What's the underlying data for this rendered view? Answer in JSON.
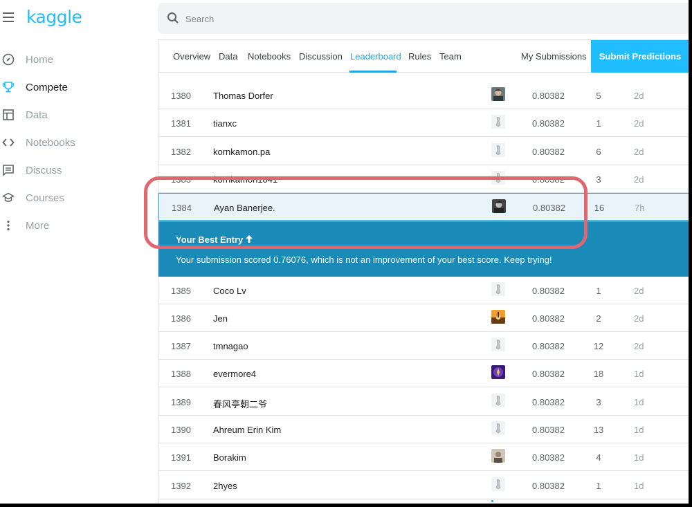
{
  "app": {
    "logo": "kaggle"
  },
  "search": {
    "placeholder": "Search"
  },
  "sidebar": {
    "items": [
      {
        "label": "Home",
        "icon": "compass-icon"
      },
      {
        "label": "Compete",
        "icon": "trophy-icon"
      },
      {
        "label": "Data",
        "icon": "table-icon"
      },
      {
        "label": "Notebooks",
        "icon": "code-icon"
      },
      {
        "label": "Discuss",
        "icon": "comment-icon"
      },
      {
        "label": "Courses",
        "icon": "graduation-cap-icon"
      },
      {
        "label": "More",
        "icon": "more-vert-icon"
      }
    ],
    "active": "Compete"
  },
  "tabs": {
    "items": [
      "Overview",
      "Data",
      "Notebooks",
      "Discussion",
      "Leaderboard",
      "Rules",
      "Team"
    ],
    "active": "Leaderboard",
    "my_submissions": "My Submissions",
    "submit": "Submit Predictions"
  },
  "leaderboard": {
    "rows": [
      {
        "rank": "1380",
        "team": "Thomas Dorfer",
        "score": "0.80382",
        "entries": "5",
        "last": "2d",
        "avatar": "photo"
      },
      {
        "rank": "1381",
        "team": "tianxc",
        "score": "0.80382",
        "entries": "1",
        "last": "2d",
        "avatar": "default"
      },
      {
        "rank": "1382",
        "team": "kornkamon.pa",
        "score": "0.80382",
        "entries": "6",
        "last": "2d",
        "avatar": "default"
      },
      {
        "rank": "1383",
        "team": "kornkamon1041",
        "score": "0.80382",
        "entries": "3",
        "last": "2d",
        "avatar": "default"
      },
      {
        "rank": "1384",
        "team": "Ayan Banerjee.",
        "score": "0.80382",
        "entries": "16",
        "last": "7h",
        "avatar": "photo-bw"
      },
      {
        "rank": "1385",
        "team": "Coco Lv",
        "score": "0.80382",
        "entries": "1",
        "last": "2d",
        "avatar": "default"
      },
      {
        "rank": "1386",
        "team": "Jen",
        "score": "0.80382",
        "entries": "2",
        "last": "2d",
        "avatar": "sunset"
      },
      {
        "rank": "1387",
        "team": "tmnagao",
        "score": "0.80382",
        "entries": "12",
        "last": "2d",
        "avatar": "default"
      },
      {
        "rank": "1388",
        "team": "evermore4",
        "score": "0.80382",
        "entries": "18",
        "last": "1d",
        "avatar": "purple"
      },
      {
        "rank": "1389",
        "team": "春风亭朝二爷",
        "score": "0.80382",
        "entries": "3",
        "last": "1d",
        "avatar": "default"
      },
      {
        "rank": "1390",
        "team": "Ahreum Erin Kim",
        "score": "0.80382",
        "entries": "13",
        "last": "1d",
        "avatar": "default"
      },
      {
        "rank": "1391",
        "team": "Borakim",
        "score": "0.80382",
        "entries": "4",
        "last": "1d",
        "avatar": "photo-light"
      },
      {
        "rank": "1392",
        "team": "2hyes",
        "score": "0.80382",
        "entries": "1",
        "last": "1d",
        "avatar": "default"
      }
    ],
    "best_entry": {
      "title": "Your Best Entry",
      "message": "Your submission scored 0.76076, which is not an improvement of your best score. Keep trying!"
    }
  },
  "colors": {
    "brand": "#20beff",
    "banner": "#1a8ab8",
    "callout": "#e06670",
    "highlight_row": "#e8f4fa"
  }
}
